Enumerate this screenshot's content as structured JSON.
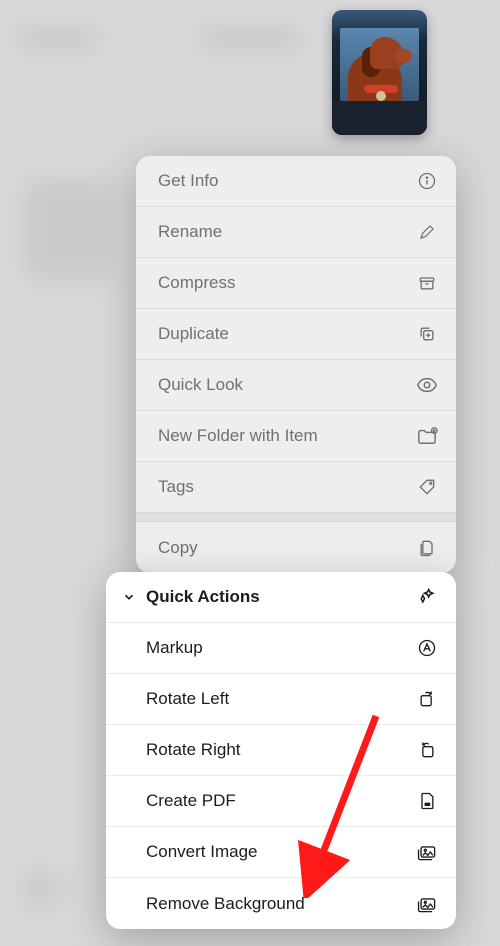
{
  "menu": {
    "items": [
      {
        "label": "Get Info",
        "icon": "info-icon"
      },
      {
        "label": "Rename",
        "icon": "pencil-icon"
      },
      {
        "label": "Compress",
        "icon": "archive-icon"
      },
      {
        "label": "Duplicate",
        "icon": "duplicate-icon"
      },
      {
        "label": "Quick Look",
        "icon": "eye-icon"
      },
      {
        "label": "New Folder with Item",
        "icon": "new-folder-icon"
      },
      {
        "label": "Tags",
        "icon": "tag-icon"
      },
      {
        "label": "Copy",
        "icon": "copy-icon"
      }
    ]
  },
  "quickActions": {
    "header": "Quick Actions",
    "items": [
      {
        "label": "Markup",
        "icon": "markup-icon"
      },
      {
        "label": "Rotate Left",
        "icon": "rotate-left-icon"
      },
      {
        "label": "Rotate Right",
        "icon": "rotate-right-icon"
      },
      {
        "label": "Create PDF",
        "icon": "pdf-icon"
      },
      {
        "label": "Convert Image",
        "icon": "convert-image-icon"
      },
      {
        "label": "Remove Background",
        "icon": "remove-background-icon"
      }
    ]
  },
  "annotation": {
    "color": "#FF1A1A"
  }
}
